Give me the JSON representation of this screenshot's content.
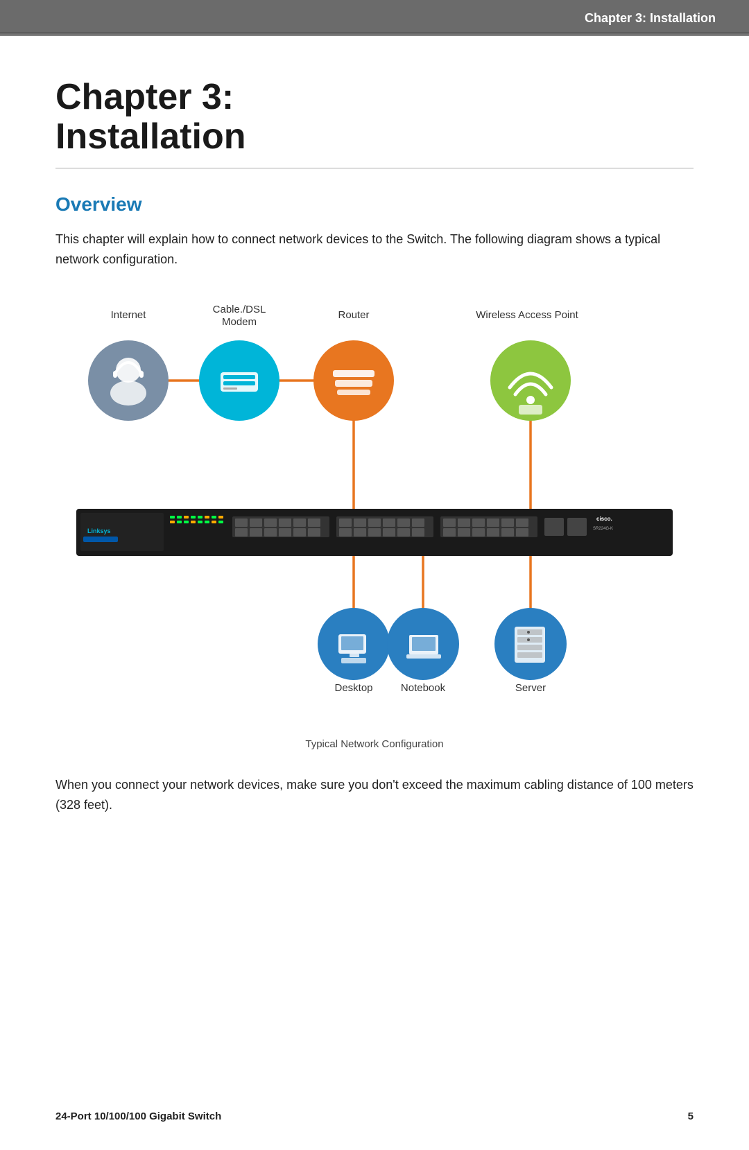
{
  "header": {
    "title": "Chapter 3: Installation"
  },
  "chapter": {
    "title_line1": "Chapter 3:",
    "title_line2": "Installation"
  },
  "overview": {
    "section_title": "Overview",
    "paragraph1": "This chapter will explain how to connect network devices to the Switch. The following diagram shows a typical network configuration.",
    "diagram_caption": "Typical Network Configuration",
    "paragraph2": "When you connect your network devices, make sure you don't exceed the maximum cabling distance of 100 meters (328 feet)."
  },
  "diagram": {
    "labels": {
      "internet": "Internet",
      "cable_dsl": "Cable./DSL",
      "modem": "Modem",
      "router": "Router",
      "wireless_ap": "Wireless Access Point",
      "desktop": "Desktop",
      "notebook": "Notebook",
      "server": "Server"
    }
  },
  "footer": {
    "product": "24-Port 10/100/100 Gigabit Switch",
    "page": "5"
  }
}
